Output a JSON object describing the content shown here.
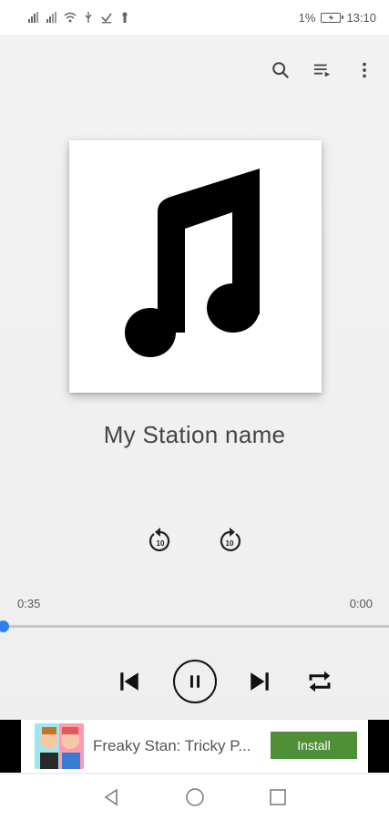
{
  "status_bar": {
    "battery_percent": "1%",
    "time": "13:10",
    "icons": [
      "signal-icon",
      "signal-icon",
      "wifi-icon",
      "usb-icon",
      "download-icon",
      "keyhole-icon"
    ]
  },
  "toolbar": {
    "icons": [
      "search-icon",
      "queue-icon",
      "more-vert-icon"
    ]
  },
  "player": {
    "artwork_icon": "music-note-icon",
    "station_name": "My Station name",
    "rewind_label": "10",
    "forward_label": "10",
    "elapsed": "0:35",
    "remaining": "0:00",
    "progress": 0.0,
    "accent_color": "#2f80ed"
  },
  "controls": {
    "icons": [
      "skip-previous-icon",
      "pause-icon",
      "skip-next-icon",
      "repeat-icon"
    ]
  },
  "ad": {
    "title": "Freaky Stan: Tricky P...",
    "install_label": "Install",
    "install_color": "#4f8f37"
  },
  "nav_bar": {
    "icons": [
      "back-icon",
      "home-icon",
      "recents-icon"
    ]
  }
}
